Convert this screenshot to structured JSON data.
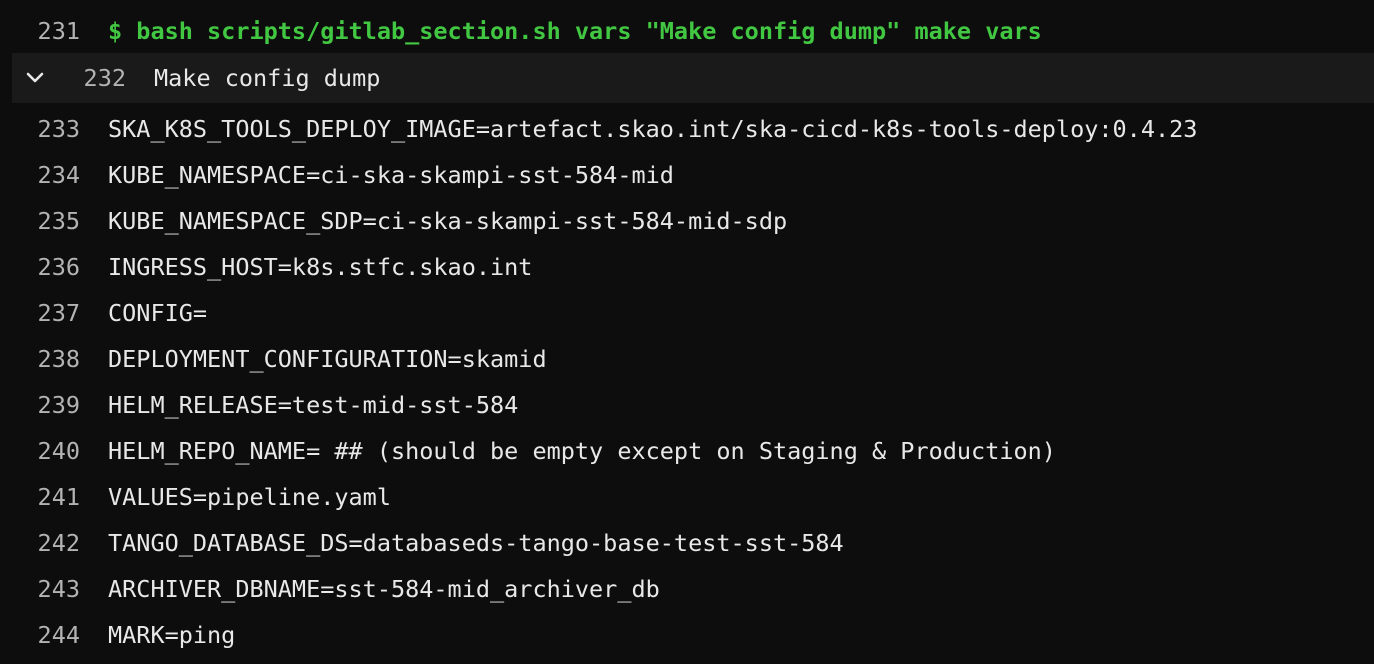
{
  "log": {
    "command_line": {
      "number": "231",
      "text": "$ bash scripts/gitlab_section.sh vars \"Make config dump\" make vars"
    },
    "section_header": {
      "number": "232",
      "text": "Make config dump",
      "icon": "chevron-down-icon"
    },
    "lines": [
      {
        "number": "233",
        "text": "SKA_K8S_TOOLS_DEPLOY_IMAGE=artefact.skao.int/ska-cicd-k8s-tools-deploy:0.4.23"
      },
      {
        "number": "234",
        "text": "KUBE_NAMESPACE=ci-ska-skampi-sst-584-mid"
      },
      {
        "number": "235",
        "text": "KUBE_NAMESPACE_SDP=ci-ska-skampi-sst-584-mid-sdp"
      },
      {
        "number": "236",
        "text": "INGRESS_HOST=k8s.stfc.skao.int"
      },
      {
        "number": "237",
        "text": "CONFIG="
      },
      {
        "number": "238",
        "text": "DEPLOYMENT_CONFIGURATION=skamid"
      },
      {
        "number": "239",
        "text": "HELM_RELEASE=test-mid-sst-584"
      },
      {
        "number": "240",
        "text": "HELM_REPO_NAME= ## (should be empty except on Staging & Production)"
      },
      {
        "number": "241",
        "text": "VALUES=pipeline.yaml"
      },
      {
        "number": "242",
        "text": "TANGO_DATABASE_DS=databaseds-tango-base-test-sst-584"
      },
      {
        "number": "243",
        "text": "ARCHIVER_DBNAME=sst-584-mid_archiver_db"
      },
      {
        "number": "244",
        "text": "MARK=ping"
      }
    ],
    "colors": {
      "background": "#0d0d0d",
      "section_background": "#1a1a1a",
      "command": "#42c742",
      "text": "#e8e8e8",
      "line_number": "#b3b3b3"
    }
  }
}
